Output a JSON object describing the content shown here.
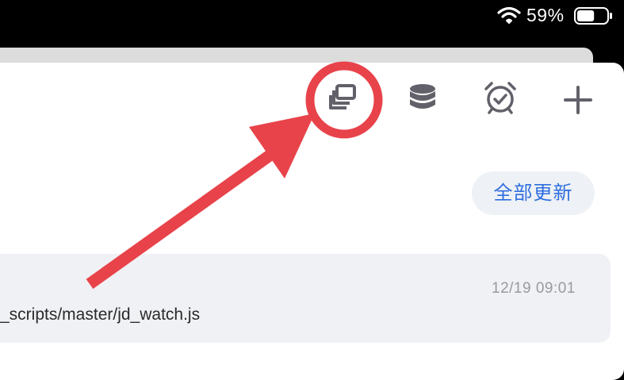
{
  "status_bar": {
    "battery_percent": "59%",
    "battery_level": 0.59,
    "icons": [
      "wifi-icon",
      "battery-icon"
    ]
  },
  "toolbar": {
    "icons": [
      "copy-windows-icon",
      "database-icon",
      "alarm-clock-icon",
      "plus-icon"
    ],
    "icon_color": "#62616a"
  },
  "main": {
    "refresh_all_label": "全部更新",
    "accent_color": "#2f6fe0"
  },
  "task": {
    "time": "12/19 09:01",
    "path": "_scripts/master/jd_watch.js"
  },
  "annotation": {
    "color": "#e8434a",
    "shapes": [
      "circle-highlight",
      "arrow"
    ]
  }
}
